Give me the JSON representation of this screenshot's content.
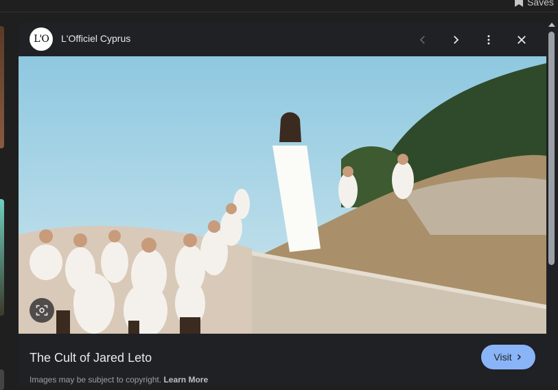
{
  "topbar": {
    "saves_label": "Saves"
  },
  "viewer": {
    "source_logo_text": "L'O",
    "source_name": "L'Officiel Cyprus",
    "title": "The Cult of Jared Leto",
    "visit_label": "Visit",
    "copyright_text": "Images may be subject to copyright.",
    "learn_more_label": "Learn More"
  },
  "icons": {
    "prev": "chevron-left-icon",
    "next": "chevron-right-icon",
    "more": "more-vertical-icon",
    "close": "close-icon",
    "lens": "lens-icon",
    "bookmark": "bookmark-icon"
  },
  "colors": {
    "accent": "#8ab4f8",
    "panel": "#202124",
    "background": "#1f1f1f"
  }
}
